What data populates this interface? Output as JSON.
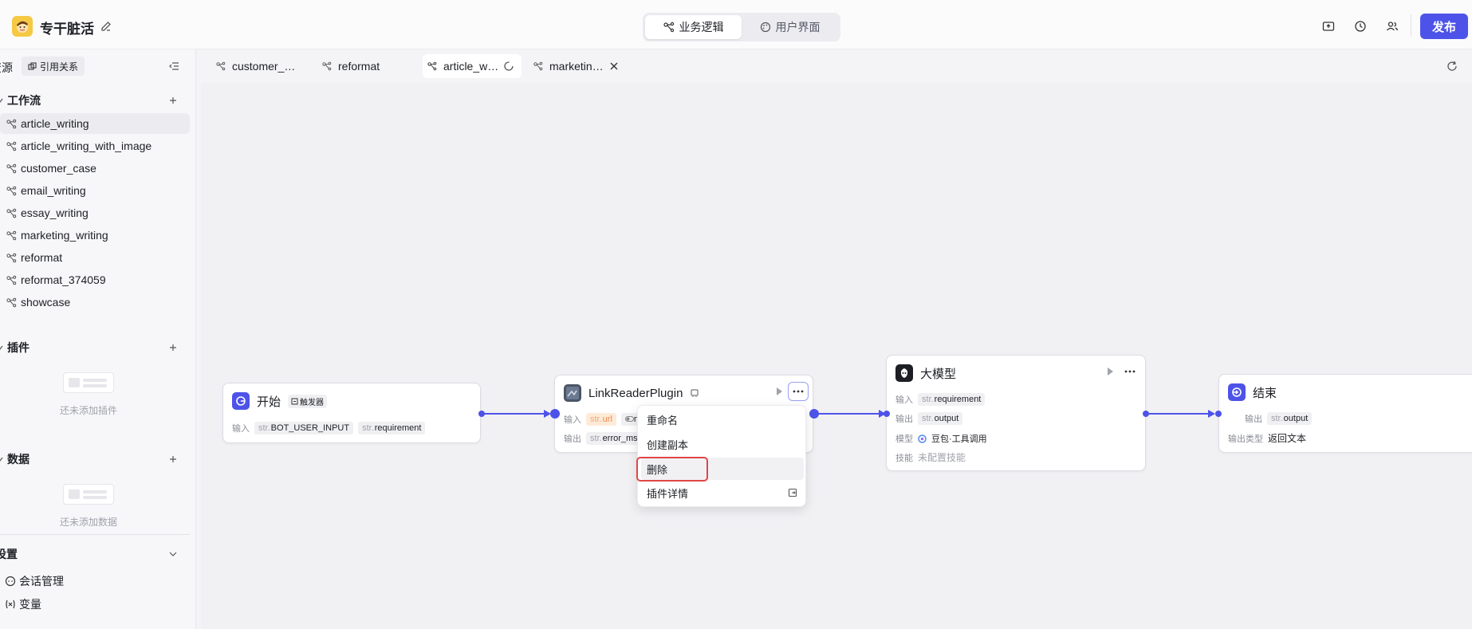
{
  "app": {
    "title": "专干脏活"
  },
  "mode_switch": {
    "logic_label": "业务逻辑",
    "ui_label": "用户界面"
  },
  "publish_label": "发布",
  "sidebar": {
    "resources_title": "资源",
    "ref_button": "引用关系",
    "workflow_section": "工作流",
    "workflows": [
      "article_writing",
      "article_writing_with_image",
      "customer_case",
      "email_writing",
      "essay_writing",
      "marketing_writing",
      "reformat",
      "reformat_374059",
      "showcase"
    ],
    "plugin_section": "插件",
    "plugin_empty": "还未添加插件",
    "data_section": "数据",
    "data_empty": "还未添加数据",
    "settings_section": "设置",
    "settings_items": [
      "会话管理",
      "变量"
    ]
  },
  "tabs": [
    "customer_…",
    "reformat",
    "article_w…",
    "marketin…"
  ],
  "nodes": {
    "start": {
      "title": "开始",
      "badge": "触发器",
      "input_label": "输入",
      "inputs": [
        {
          "type": "str.",
          "name": "BOT_USER_INPUT"
        },
        {
          "type": "str.",
          "name": "requirement"
        }
      ]
    },
    "plugin": {
      "title": "LinkReaderPlugin",
      "input_label": "输入",
      "output_label": "输出",
      "input_chip": {
        "type": "str.",
        "name": "url"
      },
      "input_chip2": "n",
      "output_chip": {
        "type": "str.",
        "name": "error_ms"
      }
    },
    "llm": {
      "title": "大模型",
      "input_label": "输入",
      "input_chip": {
        "type": "str.",
        "name": "requirement"
      },
      "output_label": "输出",
      "output_chip": {
        "type": "str.",
        "name": "output"
      },
      "model_label": "模型",
      "model_value": "豆包·工具调用",
      "skill_label": "技能",
      "skill_value": "未配置技能"
    },
    "end": {
      "title": "结束",
      "output_label": "输出",
      "output_chip": {
        "type": "str.",
        "name": "output"
      },
      "output_type_label": "输出类型",
      "output_type_value": "返回文本"
    }
  },
  "context_menu": [
    "重命名",
    "创建副本",
    "删除",
    "插件详情"
  ],
  "colors": {
    "accent": "#4d53e8",
    "highlight": "#e04646"
  }
}
